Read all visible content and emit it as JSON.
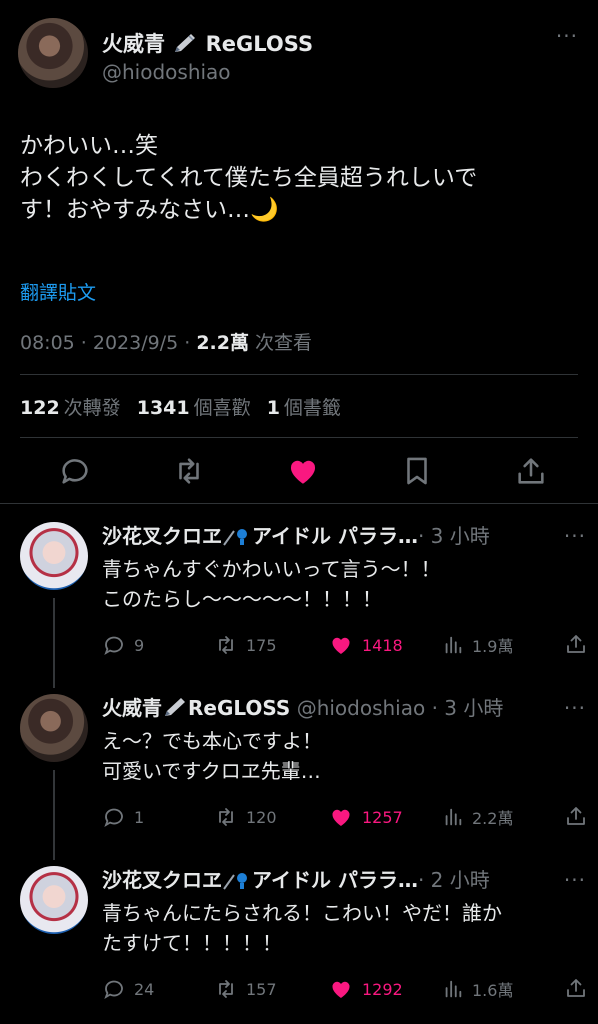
{
  "tweet": {
    "author_name": "火威青",
    "author_suffix": "ReGLOSS",
    "handle": "@hiodoshiao",
    "text": "かわいい…笑\nわくわくしてくれて僕たち全員超うれしいで\nす！おやすみなさい…🌙",
    "translate": "翻譯貼文",
    "time": "08:05 · 2023/9/5 · ",
    "views_count": "2.2萬",
    "views_label": " 次查看",
    "retweets_count": "122",
    "retweets_label": "次轉發",
    "likes_count": "1341",
    "likes_label": "個喜歡",
    "bookmarks_count": "1",
    "bookmarks_label": "個書籤",
    "more": "···"
  },
  "replies": [
    {
      "name": "沙花叉クロヱ",
      "name_tail": "アイドル パララ…",
      "meta": "· 3 小時",
      "text": "青ちゃんすぐかわいいって言う〜！！\nこのたらし〜〜〜〜〜！！！！",
      "replies": "9",
      "retweets": "175",
      "likes": "1418",
      "views": "1.9萬"
    },
    {
      "name": "火威青",
      "name_tail": "ReGLOSS",
      "meta": "@hiodoshiao · 3 小時",
      "text": "え〜？でも本心ですよ！\n可愛いですクロヱ先輩…",
      "replies": "1",
      "retweets": "120",
      "likes": "1257",
      "views": "2.2萬"
    },
    {
      "name": "沙花叉クロヱ",
      "name_tail": "アイドル パララ…",
      "meta": "· 2 小時",
      "text": "青ちゃんにたらされる！こわい！やだ！誰か\nたすけて！！！！！",
      "replies": "24",
      "retweets": "157",
      "likes": "1292",
      "views": "1.6萬"
    }
  ],
  "colors": {
    "accent": "#1d9bf0",
    "like": "#f91880",
    "muted": "#71767b",
    "text": "#e7e9ea"
  },
  "icons": [
    "pen-icon",
    "microphone-icon",
    "reply-icon",
    "retweet-icon",
    "heart-icon",
    "bookmark-icon",
    "share-icon",
    "views-icon",
    "more-icon"
  ]
}
